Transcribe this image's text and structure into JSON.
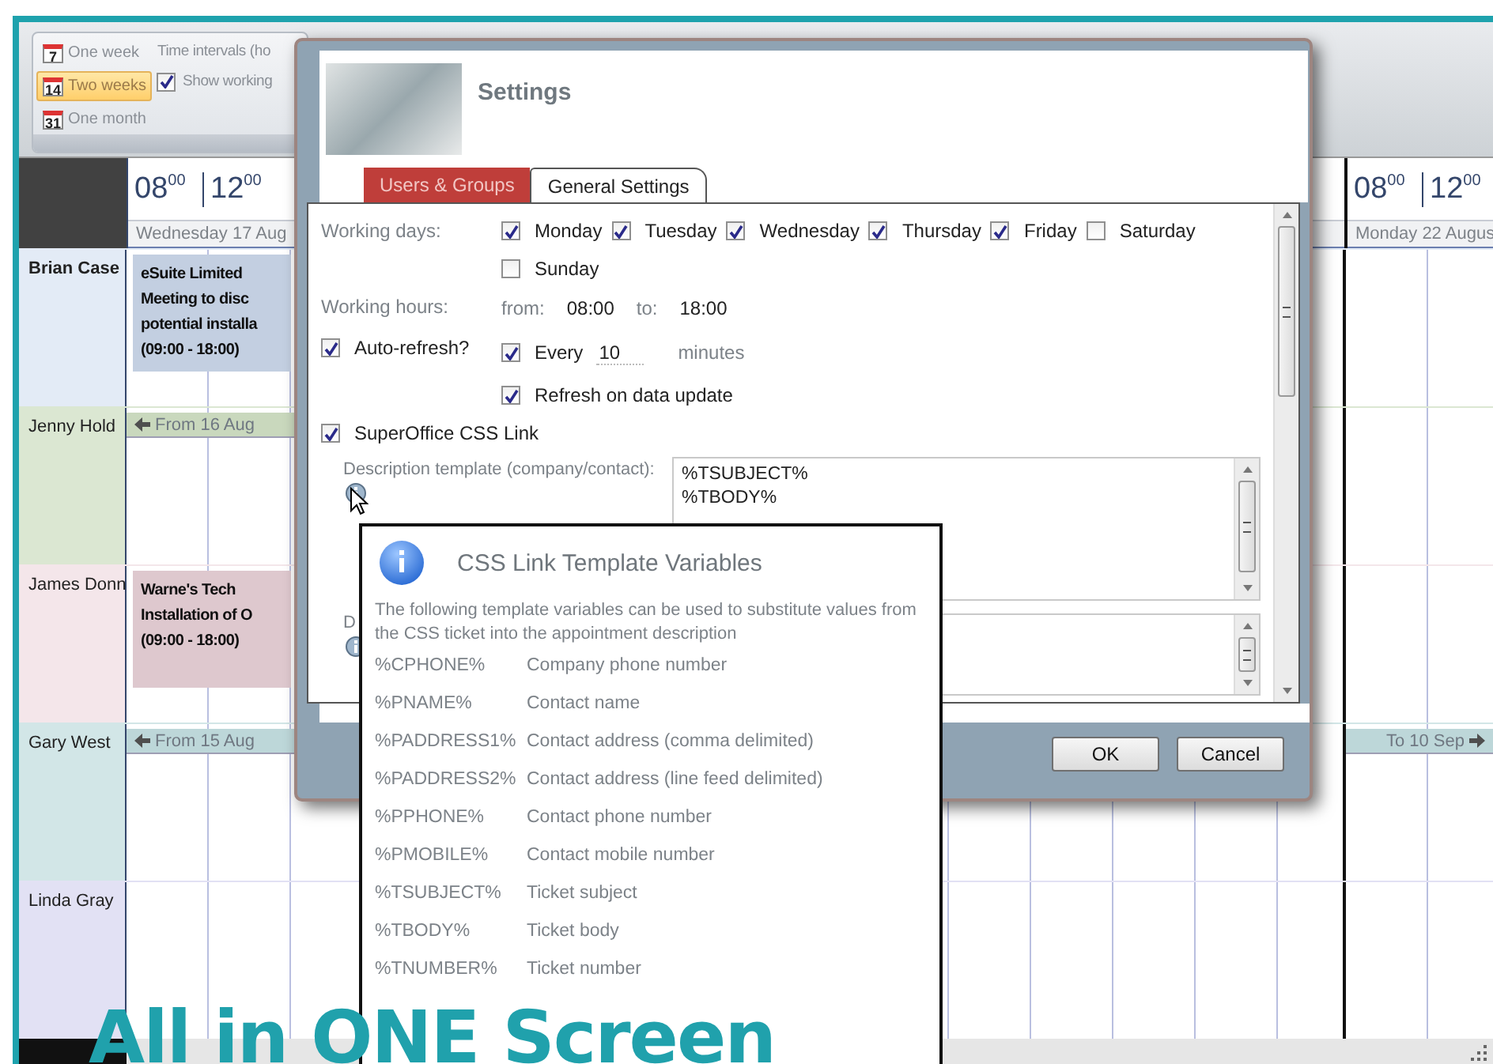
{
  "ribbon": {
    "views": [
      {
        "icon_number": "7",
        "label": "One week",
        "selected": false
      },
      {
        "icon_number": "14",
        "label": "Two weeks",
        "selected": true
      },
      {
        "icon_number": "31",
        "label": "One month",
        "selected": false
      }
    ],
    "time_intervals_label": "Time intervals (ho",
    "show_working": {
      "label": "Show working",
      "checked": true
    }
  },
  "calendar": {
    "days": [
      {
        "times": [
          {
            "hour": "08",
            "minutes": "00"
          },
          {
            "hour": "12",
            "minutes": "00"
          }
        ],
        "date": "Wednesday 17 Aug"
      },
      {
        "times": [
          {
            "hour": "08",
            "minutes": "00"
          },
          {
            "hour": "12",
            "minutes": "00"
          }
        ],
        "date": "Monday 22 Augus"
      }
    ],
    "people": [
      {
        "name": "Brian Case",
        "bold": true,
        "color": "#e3ebf6",
        "events": [
          {
            "lines": [
              "eSuite Limited",
              "Meeting to disc",
              "potential installa",
              "(09:00 - 18:00)"
            ]
          }
        ]
      },
      {
        "name": "Jenny Hold",
        "bold": false,
        "color": "#dbe7d2",
        "banners": [
          {
            "kind": "from",
            "text": "From 16 Aug"
          }
        ]
      },
      {
        "name": "James Donn",
        "bold": false,
        "color": "#f4e6ea",
        "events": [
          {
            "lines": [
              "Warne's Tech",
              "Installation of O",
              "(09:00 - 18:00)"
            ]
          }
        ]
      },
      {
        "name": "Gary West",
        "bold": false,
        "color": "#d2e6e7",
        "banners": [
          {
            "kind": "from",
            "text": "From 15 Aug"
          },
          {
            "kind": "to",
            "text": "To 10 Sep"
          }
        ]
      },
      {
        "name": "Linda Gray",
        "bold": false,
        "color": "#e2e1f4"
      }
    ]
  },
  "dialog": {
    "title": "Settings",
    "tabs": [
      {
        "label": "Users & Groups",
        "selected": false
      },
      {
        "label": "General Settings",
        "selected": true
      }
    ],
    "working_days": {
      "label": "Working days:",
      "days": [
        {
          "label": "Monday",
          "checked": true
        },
        {
          "label": "Tuesday",
          "checked": true
        },
        {
          "label": "Wednesday",
          "checked": true
        },
        {
          "label": "Thursday",
          "checked": true
        },
        {
          "label": "Friday",
          "checked": true
        },
        {
          "label": "Saturday",
          "checked": false
        },
        {
          "label": "Sunday",
          "checked": false
        }
      ]
    },
    "working_hours": {
      "label": "Working hours:",
      "from_label": "from:",
      "from": "08:00",
      "to_label": "to:",
      "to": "18:00"
    },
    "auto_refresh": {
      "label": "Auto-refresh?",
      "checked": true,
      "every_label": "Every",
      "every_checked": true,
      "every_value": "10",
      "unit": "minutes"
    },
    "refresh_on_update": {
      "label": "Refresh on data update",
      "checked": true
    },
    "css_link": {
      "label": "SuperOffice CSS Link",
      "checked": true
    },
    "description_template": {
      "label": "Description template (company/contact):",
      "lines": [
        "%TSUBJECT%",
        "%TBODY%"
      ]
    },
    "second_template": {
      "label": "D"
    },
    "buttons": [
      "OK",
      "Cancel"
    ]
  },
  "popup": {
    "title": "CSS Link Template Variables",
    "intro": "The following template variables can be used to substitute values from the CSS ticket into the appointment description",
    "variables": [
      {
        "name": "%CPHONE%",
        "description": "Company phone number"
      },
      {
        "name": "%PNAME%",
        "description": "Contact name"
      },
      {
        "name": "%PADDRESS1%",
        "description": "Contact address (comma delimited)"
      },
      {
        "name": "%PADDRESS2%",
        "description": "Contact address (line feed delimited)"
      },
      {
        "name": "%PPHONE%",
        "description": "Contact phone number"
      },
      {
        "name": "%PMOBILE%",
        "description": "Contact mobile number"
      },
      {
        "name": "%TSUBJECT%",
        "description": "Ticket subject"
      },
      {
        "name": "%TBODY%",
        "description": "Ticket body"
      },
      {
        "name": "%TNUMBER%",
        "description": "Ticket number"
      }
    ]
  },
  "caption": "All in ONE Screen"
}
